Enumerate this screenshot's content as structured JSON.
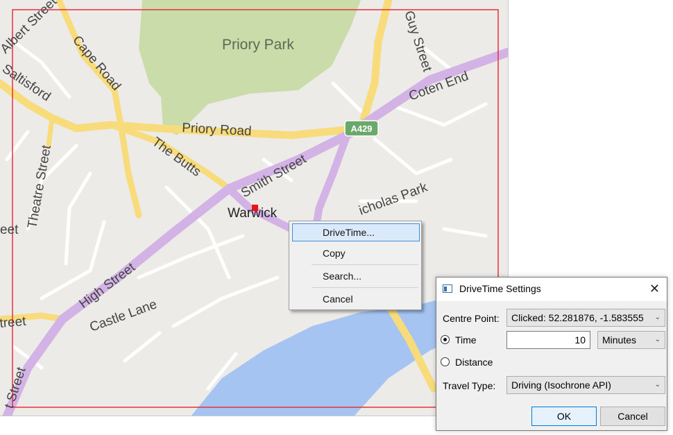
{
  "map": {
    "labels": {
      "albert_street": "Albert Street",
      "cape_road": "Cape Road",
      "saltisford": "Saltisford",
      "priory_park": "Priory Park",
      "guy_street": "Guy Street",
      "coten_end": "Coten End",
      "priory_road": "Priory Road",
      "a429": "A429",
      "the_butts": "The Butts",
      "smith_street": "Smith Street",
      "theatre_street": "Theatre Street",
      "warwick": "Warwick",
      "st_nicholas_park": "icholas Park",
      "high_street": "High Street",
      "castle_lane": "Castle Lane",
      "eet_left": "eet",
      "street_left": "treet",
      "street_bottom": "t Street"
    },
    "colors": {
      "background": "#ecebe8",
      "park": "#cbdcab",
      "water": "#a6c4f2",
      "major_road": "#f8dc7c",
      "a_road": "#d3b3e6",
      "selection_box": "#e8303a",
      "marker": "#ee1111"
    }
  },
  "context_menu": {
    "items": [
      "DriveTime...",
      "Copy",
      "Search...",
      "Cancel"
    ]
  },
  "dialog": {
    "title": "DriveTime Settings",
    "close_glyph": "✕",
    "centre_point_label": "Centre Point:",
    "centre_point_value": "Clicked: 52.281876, -1.583555",
    "time_label": "Time",
    "time_value": "10",
    "time_unit": "Minutes",
    "distance_label": "Distance",
    "travel_type_label": "Travel Type:",
    "travel_type_value": "Driving (Isochrone API)",
    "ok_label": "OK",
    "cancel_label": "Cancel",
    "selected_mode": "Time",
    "chevron_glyph": "⌄"
  }
}
